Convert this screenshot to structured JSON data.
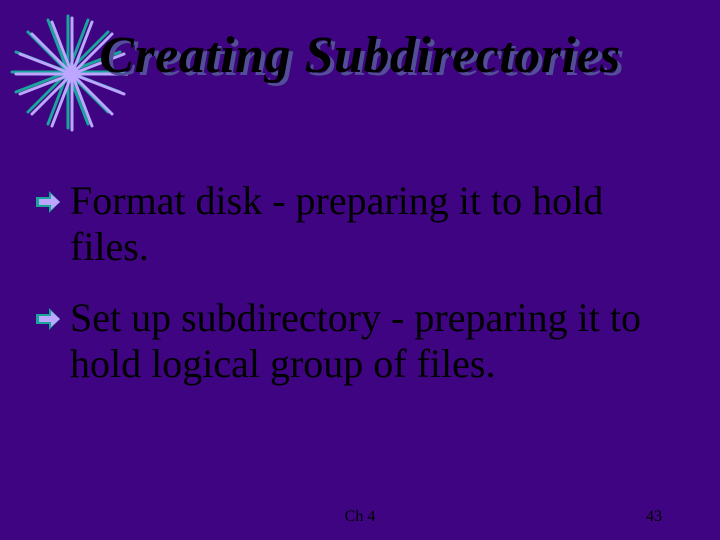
{
  "title": "Creating Subdirectories",
  "bullets": [
    {
      "text": "Format disk - preparing it to hold files."
    },
    {
      "text": "Set up subdirectory - preparing it to hold logical group of files."
    }
  ],
  "footer": {
    "center": "Ch 4",
    "page": "43"
  },
  "colors": {
    "background": "#3e0481",
    "accent_teal": "#1aa59c",
    "accent_lavender": "#bda6ff",
    "title_shadow": "#524e98"
  }
}
